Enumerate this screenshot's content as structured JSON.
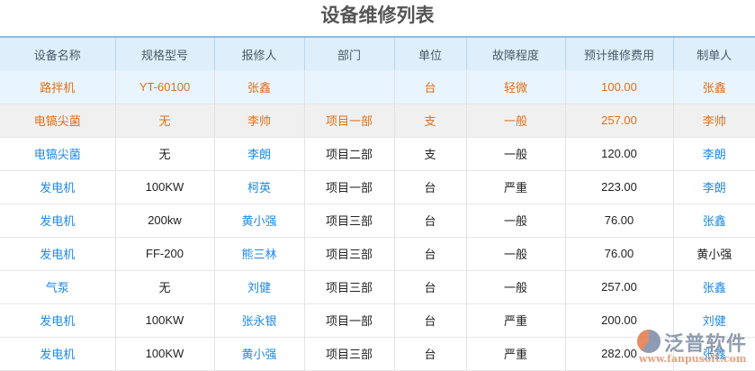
{
  "title": "设备维修列表",
  "headers": [
    "设备名称",
    "规格型号",
    "报修人",
    "部门",
    "单位",
    "故障程度",
    "预计维修费用",
    "制单人"
  ],
  "rows": [
    [
      "路拌机",
      "YT-60100",
      "张鑫",
      "",
      "台",
      "轻微",
      "100.00",
      "张鑫"
    ],
    [
      "电镐尖菌",
      "无",
      "李帅",
      "项目一部",
      "支",
      "一般",
      "257.00",
      "李帅"
    ],
    [
      "电镐尖菌",
      "无",
      "李朗",
      "项目二部",
      "支",
      "一般",
      "120.00",
      "李朗"
    ],
    [
      "发电机",
      "100KW",
      "柯英",
      "项目一部",
      "台",
      "严重",
      "223.00",
      "李朗"
    ],
    [
      "发电机",
      "200kw",
      "黄小强",
      "项目三部",
      "台",
      "一般",
      "76.00",
      "张鑫"
    ],
    [
      "发电机",
      "FF-200",
      "熊三林",
      "项目三部",
      "台",
      "一般",
      "76.00",
      "黄小强"
    ],
    [
      "气泵",
      "无",
      "刘健",
      "项目三部",
      "台",
      "一般",
      "257.00",
      "张鑫"
    ],
    [
      "发电机",
      "100KW",
      "张永银",
      "项目一部",
      "台",
      "严重",
      "200.00",
      "刘健"
    ],
    [
      "发电机",
      "100KW",
      "黄小强",
      "项目三部",
      "台",
      "严重",
      "282.00",
      "张鑫"
    ]
  ],
  "watermark": {
    "name": "泛普软件",
    "url": "www.fanpusoft.com"
  }
}
